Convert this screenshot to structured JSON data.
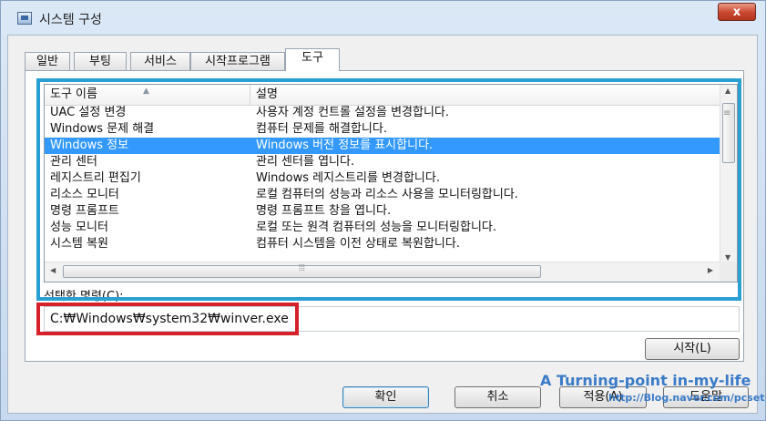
{
  "window": {
    "title": "시스템 구성",
    "close_label": "x"
  },
  "tabs": [
    "일반",
    "부팅",
    "서비스",
    "시작프로그램",
    "도구"
  ],
  "list": {
    "columns": [
      "도구 이름",
      "설명"
    ],
    "rows": [
      {
        "name": "UAC 설정 변경",
        "desc": "사용자 계정 컨트롤 설정을 변경합니다."
      },
      {
        "name": "Windows 문제 해결",
        "desc": "컴퓨터 문제를 해결합니다."
      },
      {
        "name": "Windows 정보",
        "desc": "Windows 버전 정보를 표시합니다."
      },
      {
        "name": "관리 센터",
        "desc": "관리 센터를 엽니다."
      },
      {
        "name": "레지스트리 편집기",
        "desc": "Windows 레지스트리를 변경합니다."
      },
      {
        "name": "리소스 모니터",
        "desc": "로컬 컴퓨터의 성능과 리소스 사용을 모니터링합니다."
      },
      {
        "name": "명령 프롬프트",
        "desc": "명령 프롬프트 창을 엽니다."
      },
      {
        "name": "성능 모니터",
        "desc": "로컬 또는 원격 컴퓨터의 성능을 모니터링합니다."
      },
      {
        "name": "시스템 복원",
        "desc": "컴퓨터 시스템을 이전 상태로 복원합니다."
      }
    ],
    "selected_index": 2
  },
  "command": {
    "label": "선택한 명령(C):",
    "value": "C:₩Windows₩system32₩winver.exe"
  },
  "buttons": {
    "launch": "시작(L)",
    "ok": "확인",
    "cancel": "취소",
    "apply": "적용(A)",
    "help": "도움말"
  },
  "watermark": {
    "line1": "A Turning-point in-my-life",
    "line2": "http://Blog.naver.com/pcset"
  },
  "colors": {
    "selection": "#3399ff",
    "blue_highlight": "#2a9fd1",
    "red_highlight": "#d6202a"
  }
}
